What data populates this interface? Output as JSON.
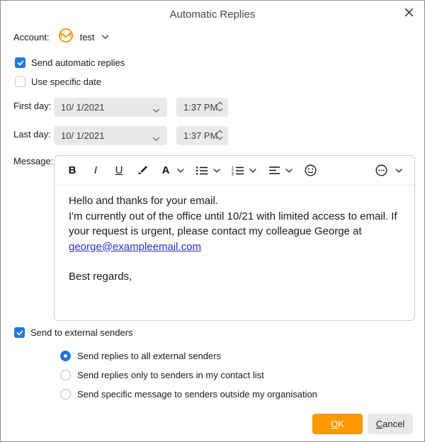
{
  "dialog": {
    "title": "Automatic Replies"
  },
  "account": {
    "label": "Account:",
    "value": "test",
    "icon": "emclient-envelope-icon"
  },
  "options": {
    "send_automatic_replies": {
      "label": "Send automatic replies",
      "checked": true
    },
    "use_specific_date": {
      "label": "Use specific date",
      "checked": false
    }
  },
  "dates": {
    "first_day": {
      "label": "First day:",
      "date": "10/ 1/2021",
      "time": "1:37 PM",
      "disabled": true
    },
    "last_day": {
      "label": "Last day:",
      "date": "10/ 1/2021",
      "time": "1:37 PM",
      "disabled": true
    }
  },
  "message": {
    "label": "Message:",
    "toolbar_glyphs": {
      "bold": "B",
      "italic": "I",
      "underline": "U",
      "font_color": "A"
    },
    "line1": "Hello and thanks for your email.",
    "body_lines": "I'm currently out of the office until 10/21 with limited access to email. If\nyour request is urgent, please contact my colleague George at\n",
    "link": "george@exampleemail.com",
    "closing": "Best regards,"
  },
  "external": {
    "label": "Send to external senders",
    "checked": true,
    "radios": [
      {
        "label": "Send replies to all external senders",
        "selected": true
      },
      {
        "label": "Send replies only to senders in my contact list",
        "selected": false
      },
      {
        "label": "Send specific message to senders outside my organisation",
        "selected": false
      }
    ]
  },
  "buttons": {
    "ok_accesskey": "O",
    "ok_rest": "K",
    "cancel_accesskey": "C",
    "cancel_rest": "ancel"
  },
  "colors": {
    "accent_blue": "#2379e0",
    "ok_orange": "#ff9800",
    "link_blue": "#2b2bd7",
    "brand_orange": "#f49a19",
    "disabled_field_bg": "#e9e9e9"
  }
}
